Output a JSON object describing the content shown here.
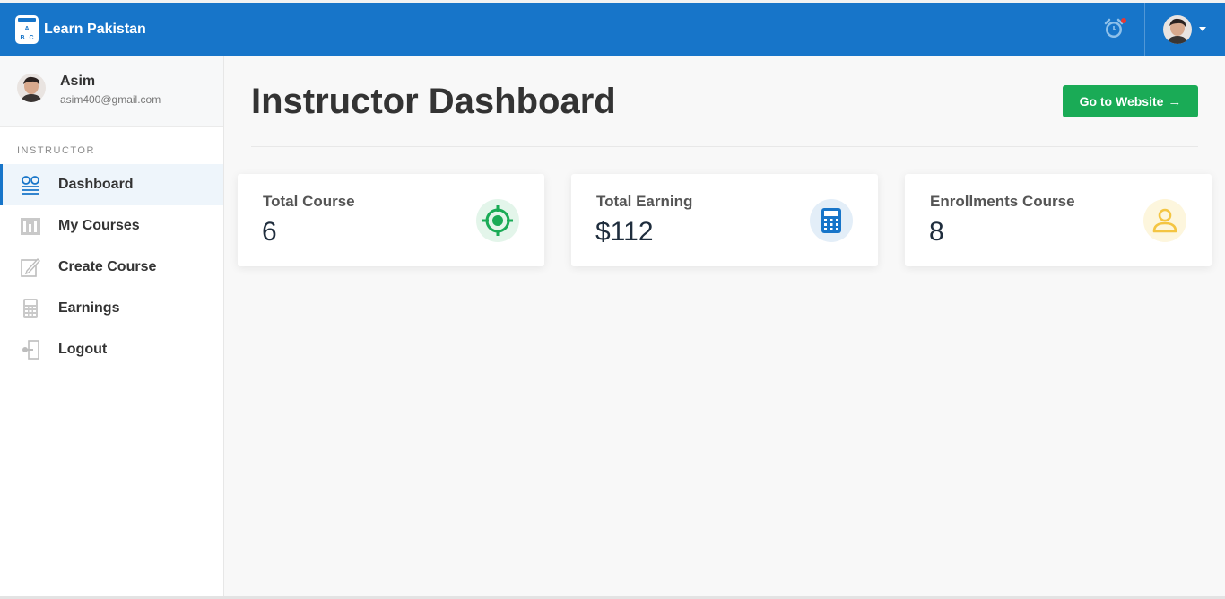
{
  "topbar": {
    "brand_name": "Learn Pakistan",
    "brand_logo_letters": "A B C",
    "accent": "#1775c9"
  },
  "user": {
    "name": "Asim",
    "email": "asim400@gmail.com"
  },
  "sidebar": {
    "section_label": "INSTRUCTOR",
    "items": [
      {
        "label": "Dashboard",
        "icon": "dashboard-icon",
        "active": true
      },
      {
        "label": "My Courses",
        "icon": "courses-icon",
        "active": false
      },
      {
        "label": "Create Course",
        "icon": "edit-icon",
        "active": false
      },
      {
        "label": "Earnings",
        "icon": "calculator-icon",
        "active": false
      },
      {
        "label": "Logout",
        "icon": "logout-icon",
        "active": false
      }
    ]
  },
  "main": {
    "title": "Instructor Dashboard",
    "go_button_label": "Go to Website",
    "go_button_color": "#1aab56"
  },
  "stats": [
    {
      "title": "Total Course",
      "value": "6",
      "icon": "target-icon",
      "color": "#1aab56"
    },
    {
      "title": "Total Earning",
      "value": "$112",
      "icon": "calculator-icon",
      "color": "#1775c9"
    },
    {
      "title": "Enrollments Course",
      "value": "8",
      "icon": "user-icon",
      "color": "#f4c542"
    }
  ]
}
